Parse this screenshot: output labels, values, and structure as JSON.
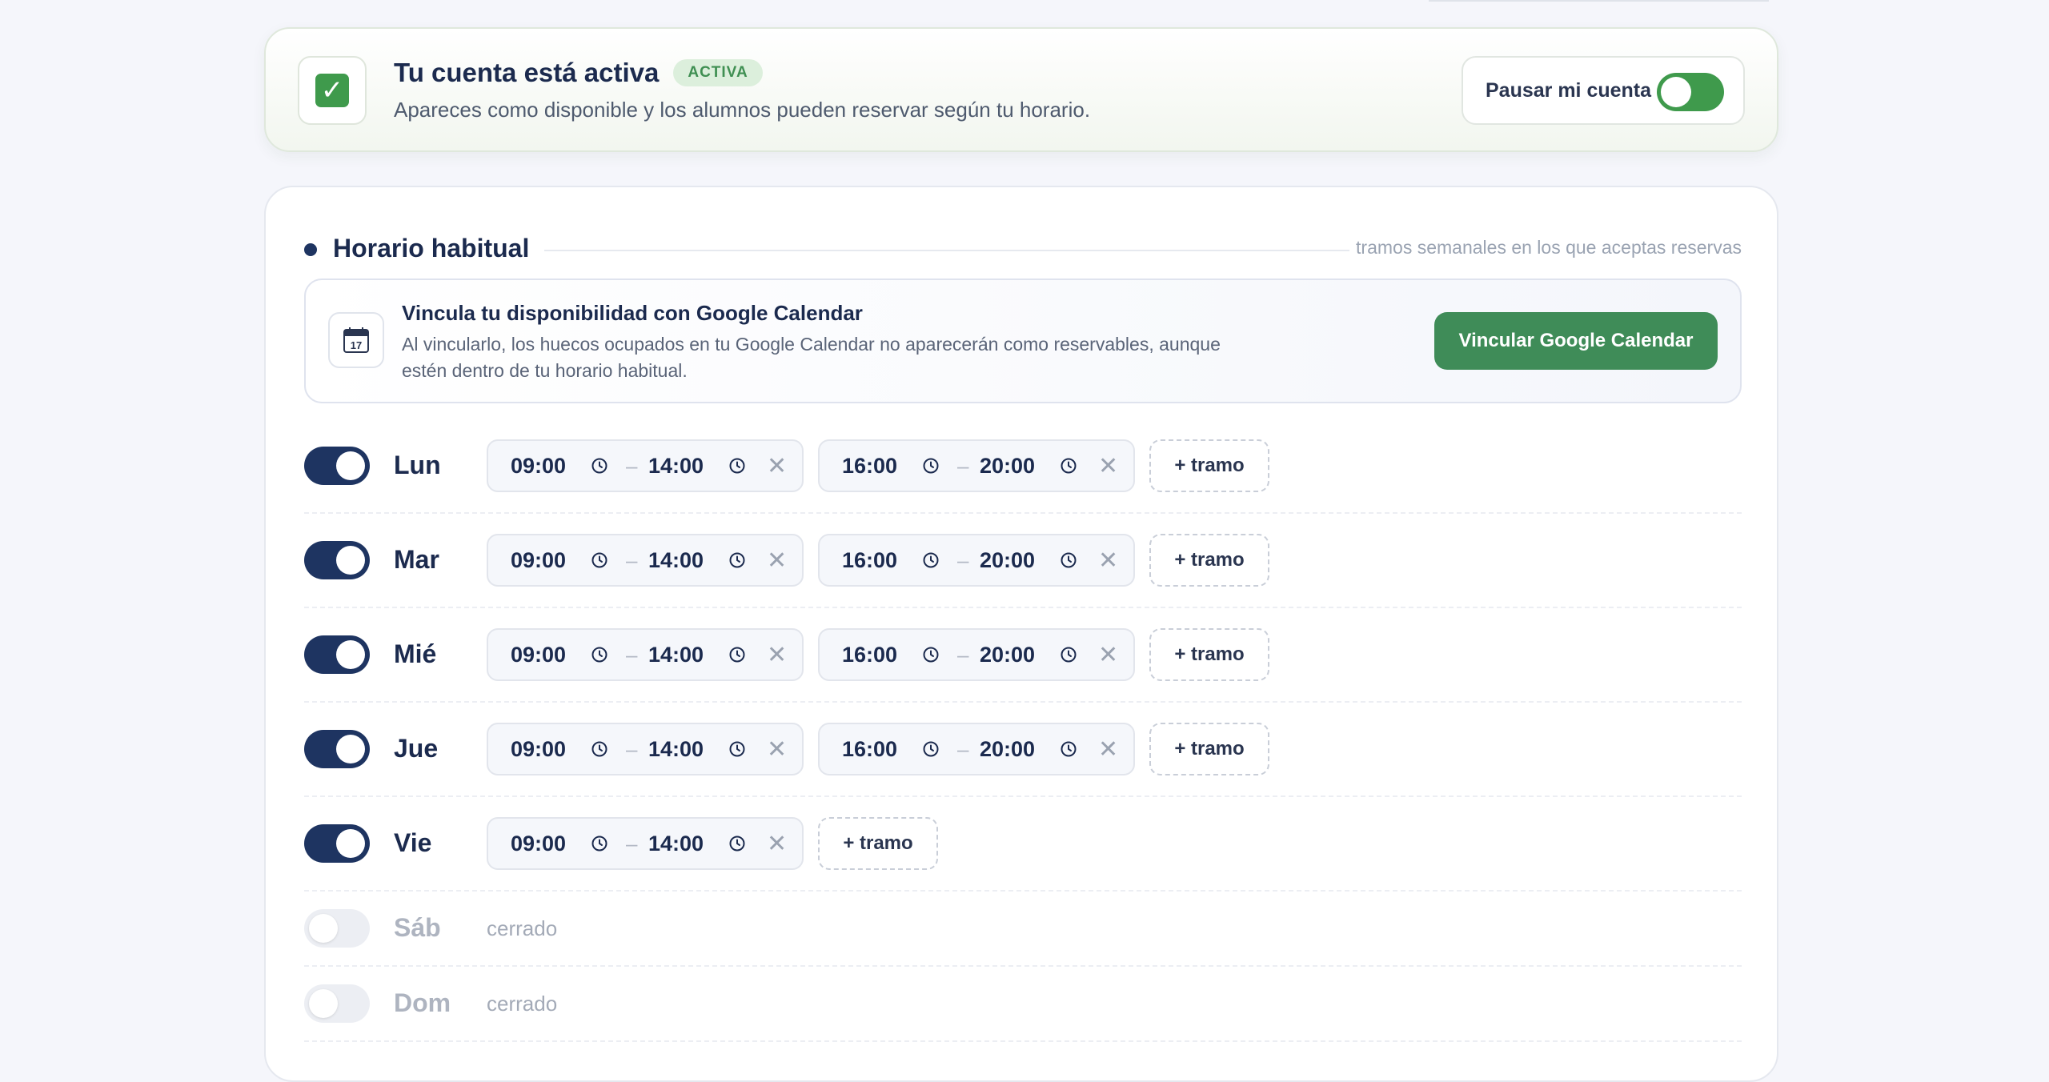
{
  "status": {
    "title": "Tu cuenta está activa",
    "badge": "ACTIVA",
    "subtitle": "Apareces como disponible y los alumnos pueden reservar según tu horario.",
    "pause_label": "Pausar mi cuenta",
    "pause_on": false,
    "accent": "#3f9a4c"
  },
  "schedule": {
    "title": "Horario habitual",
    "note": "tramos semanales en los que aceptas reservas",
    "gcal": {
      "title": "Vincula tu disponibilidad con Google Calendar",
      "desc": "Al vincularlo, los huecos ocupados en tu Google Calendar no aparecerán como reservables, aunque estén dentro de tu horario habitual.",
      "button": "Vincular Google Calendar",
      "icon_day": "17"
    },
    "add_label": "+ tramo",
    "closed_label": "cerrado",
    "separator": "–",
    "remove_symbol": "✕",
    "days": [
      {
        "label": "Lun",
        "enabled": true,
        "slots": [
          {
            "start": "09:00",
            "end": "14:00"
          },
          {
            "start": "16:00",
            "end": "20:00"
          }
        ]
      },
      {
        "label": "Mar",
        "enabled": true,
        "slots": [
          {
            "start": "09:00",
            "end": "14:00"
          },
          {
            "start": "16:00",
            "end": "20:00"
          }
        ]
      },
      {
        "label": "Mié",
        "enabled": true,
        "slots": [
          {
            "start": "09:00",
            "end": "14:00"
          },
          {
            "start": "16:00",
            "end": "20:00"
          }
        ]
      },
      {
        "label": "Jue",
        "enabled": true,
        "slots": [
          {
            "start": "09:00",
            "end": "14:00"
          },
          {
            "start": "16:00",
            "end": "20:00"
          }
        ]
      },
      {
        "label": "Vie",
        "enabled": true,
        "slots": [
          {
            "start": "09:00",
            "end": "14:00"
          }
        ]
      },
      {
        "label": "Sáb",
        "enabled": false,
        "slots": []
      },
      {
        "label": "Dom",
        "enabled": false,
        "slots": []
      }
    ],
    "toggle_color": "#1e3461",
    "button_color": "#3f8c58"
  }
}
